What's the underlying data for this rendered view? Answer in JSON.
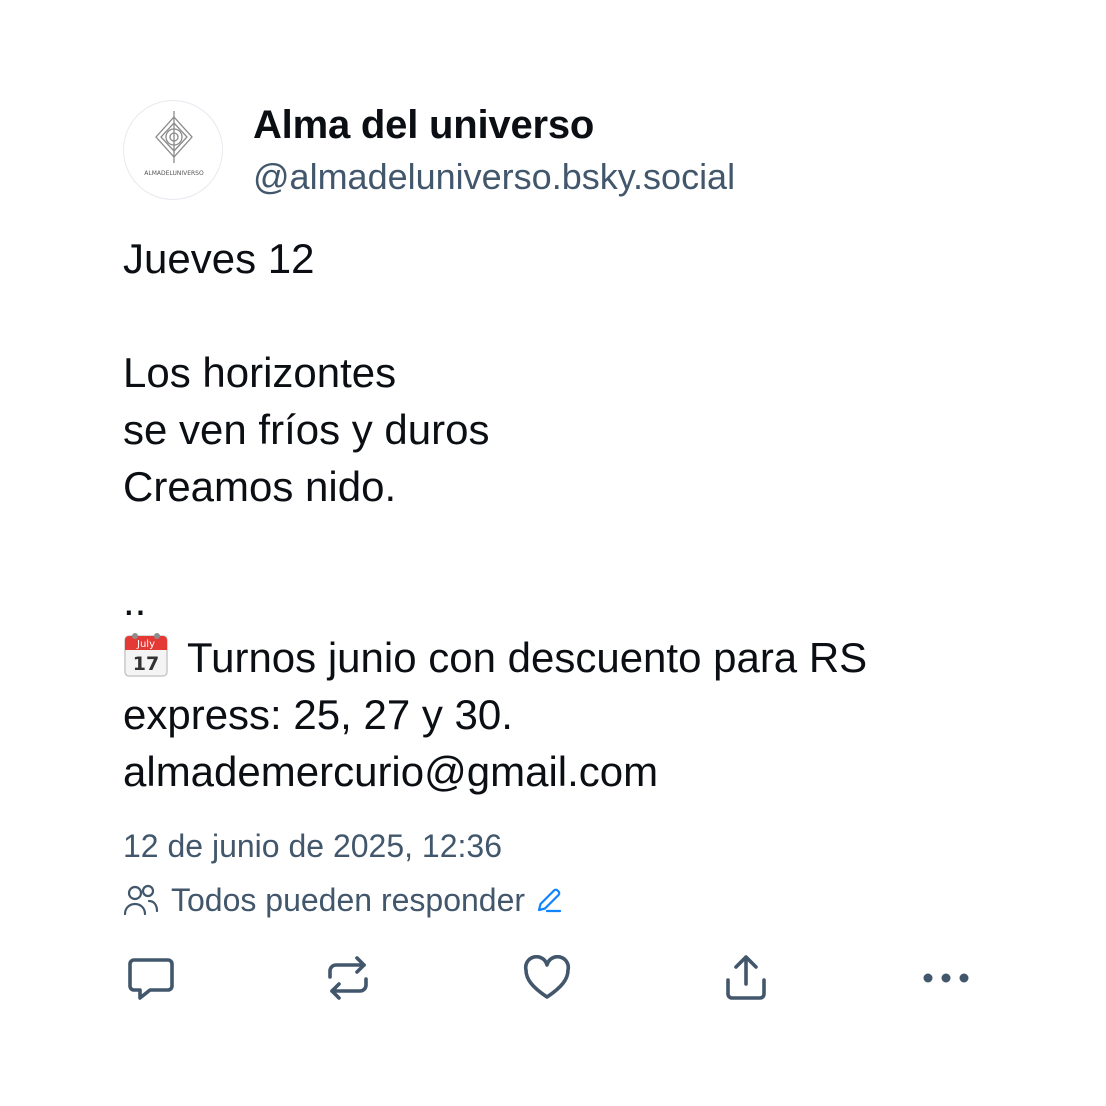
{
  "author": {
    "display_name": "Alma del universo",
    "handle": "@almadeluniverso.bsky.social",
    "avatar_logo_text": "ALMADELUNIVERSO"
  },
  "post": {
    "line_1": "Jueves 12",
    "line_2": "Los horizontes",
    "line_3": "se ven fríos y duros",
    "line_4": "Creamos nido.",
    "line_5": "..",
    "calendar_emoji": {
      "month": "July",
      "day": "17"
    },
    "line_6": "Turnos junio con descuento para RS",
    "line_7": "express: 25, 27 y 30.",
    "line_8": "almademercurio@gmail.com"
  },
  "timestamp": "12 de junio de 2025, 12:36",
  "reply_settings": {
    "label": "Todos pueden responder"
  },
  "actions": [
    "reply-icon",
    "repost-icon",
    "like-icon",
    "share-icon",
    "more-options-icon"
  ],
  "colors": {
    "text_primary": "#0b0f14",
    "text_secondary": "#42576c",
    "accent": "#1083fe",
    "icon": "#42576c"
  }
}
